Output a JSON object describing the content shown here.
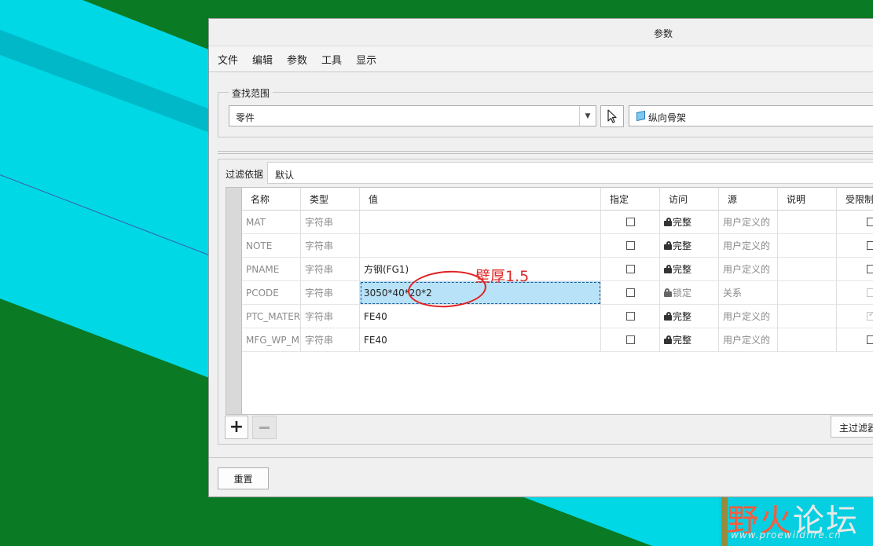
{
  "window": {
    "title": "参数"
  },
  "menu": [
    "文件",
    "编辑",
    "参数",
    "工具",
    "显示"
  ],
  "scope": {
    "label": "查找范围",
    "type_value": "零件",
    "object_value": "纵向骨架"
  },
  "filter": {
    "label": "过滤依据",
    "value": "默认"
  },
  "table": {
    "headers": [
      "名称",
      "类型",
      "值",
      "指定",
      "访问",
      "源",
      "说明",
      "受限制"
    ],
    "rows": [
      {
        "name": "MAT",
        "type": "字符串",
        "value": "",
        "access": "完整",
        "source": "用户定义的"
      },
      {
        "name": "NOTE",
        "type": "字符串",
        "value": "",
        "access": "完整",
        "source": "用户定义的"
      },
      {
        "name": "PNAME",
        "type": "字符串",
        "value": "方钢(FG1)",
        "access": "完整",
        "source": "用户定义的"
      },
      {
        "name": "PCODE",
        "type": "字符串",
        "value": "3050*40*20*2",
        "access": "锁定",
        "source": "关系"
      },
      {
        "name": "PTC_MATERIAL",
        "type": "字符串",
        "value": "FE40",
        "access": "完整",
        "source": "用户定义的"
      },
      {
        "name": "MFG_WP_M",
        "type": "字符串",
        "value": "FE40",
        "access": "完整",
        "source": "用户定义的"
      }
    ]
  },
  "buttons": {
    "add": "+",
    "main_filter": "主过滤器",
    "reset": "重置"
  },
  "annotation": {
    "text": "壁厚1.5"
  },
  "watermark": {
    "part1": "野",
    "part2": "火",
    "part3": "论坛",
    "url": "www.proewildfire.cn"
  }
}
